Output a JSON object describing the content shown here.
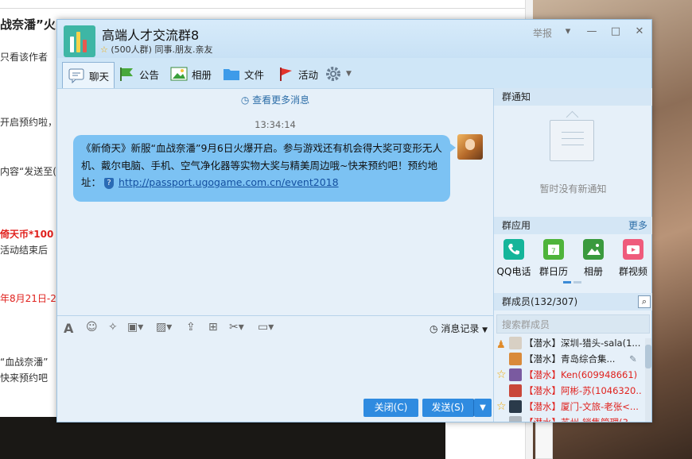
{
  "background": {
    "title": "战奈潘”火",
    "lines": [
      "只看该作者",
      "开启预约啦，",
      "内容“发送至(",
      "倚天币*100（",
      "活动结束后",
      "年8月21日-2",
      "“血战奈潘”",
      "快来预约吧"
    ]
  },
  "window": {
    "title": "高端人才交流群8",
    "member_count": "(500人群)",
    "tags": "同事.朋友.亲友",
    "report": "举报",
    "controls": [
      "▾",
      "—",
      "□",
      "✕"
    ]
  },
  "toolbar": {
    "items": [
      {
        "label": "聊天",
        "icon": "chat-icon"
      },
      {
        "label": "公告",
        "icon": "announcement-flag-icon"
      },
      {
        "label": "相册",
        "icon": "photo-album-icon"
      },
      {
        "label": "文件",
        "icon": "folder-icon"
      },
      {
        "label": "活动",
        "icon": "activity-flag-icon"
      }
    ],
    "settings_icon": "gear-icon"
  },
  "chat": {
    "more_messages": "查看更多消息",
    "timestamp": "13:34:14",
    "message_text": "《新倚天》新服“血战奈潘”9月6日火爆开启。参与游戏还有机会得大奖可变形无人机、戴尔电脑、手机、空气净化器等实物大奖与精美周边哦~快来预约吧！预约地址：",
    "message_link": "http://passport.ugogame.com.cn/event2018"
  },
  "input": {
    "tool_icons": [
      "font-icon",
      "emoji-icon",
      "magic-wand-icon",
      "game-icon",
      "image-icon",
      "upload-icon",
      "gift-icon",
      "scissors-icon",
      "screenshot-icon"
    ],
    "history_label": "消息记录",
    "close_label": "关闭(C)",
    "send_label": "发送(S)"
  },
  "right_panel": {
    "notice_header": "群通知",
    "notice_empty": "暂时没有新通知",
    "apps_header": "群应用",
    "apps_more": "更多",
    "apps": [
      {
        "label": "QQ电话",
        "color": "#15b59a"
      },
      {
        "label": "群日历",
        "color": "#4fb43b"
      },
      {
        "label": "相册",
        "color": "#3a9a3e"
      },
      {
        "label": "群视频",
        "color": "#ef5b7c"
      }
    ],
    "members_header": "群成员(132/307)",
    "search_placeholder": "搜索群成员",
    "members": [
      {
        "text": "【潜水】深圳-猎头-sala(1...",
        "red": false
      },
      {
        "text": "【潜水】青岛综合集...",
        "red": false
      },
      {
        "text": "【潜水】Ken(609948661)",
        "red": true
      },
      {
        "text": "【潜水】阿彬-苏(1046320...",
        "red": true
      },
      {
        "text": "【潜水】厦门-文旅-老张<...",
        "red": true
      },
      {
        "text": "【潜水】苏州-销售管理(3",
        "red": true
      }
    ]
  }
}
